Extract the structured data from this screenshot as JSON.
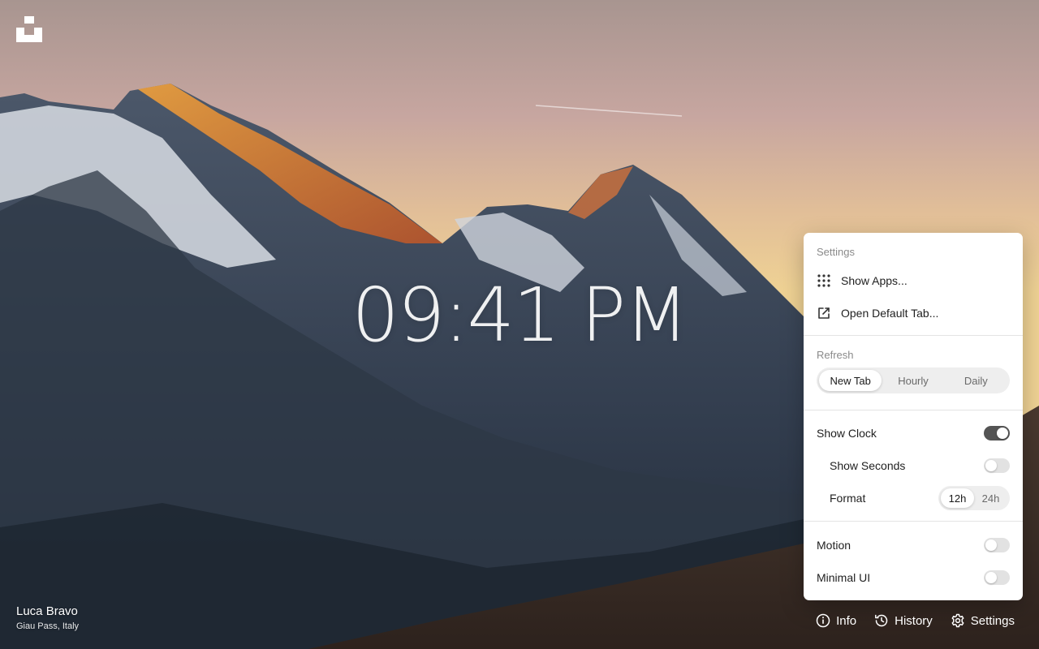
{
  "clock": {
    "time": "09:41 PM"
  },
  "credit": {
    "name": "Luca Bravo",
    "location": "Giau Pass, Italy"
  },
  "settings": {
    "title": "Settings",
    "menu": [
      {
        "label": "Show Apps...",
        "icon": "grid-icon"
      },
      {
        "label": "Open Default Tab...",
        "icon": "external-link-icon"
      }
    ],
    "refresh": {
      "title": "Refresh",
      "options": [
        "New Tab",
        "Hourly",
        "Daily"
      ],
      "selected": "New Tab"
    },
    "show_clock": {
      "label": "Show Clock",
      "on": true
    },
    "show_seconds": {
      "label": "Show Seconds",
      "on": false
    },
    "format": {
      "label": "Format",
      "options": [
        "12h",
        "24h"
      ],
      "selected": "12h"
    },
    "motion": {
      "label": "Motion",
      "on": false
    },
    "minimal_ui": {
      "label": "Minimal UI",
      "on": false
    }
  },
  "footer": {
    "info": {
      "label": "Info",
      "icon": "info-icon"
    },
    "history": {
      "label": "History",
      "icon": "history-icon"
    },
    "settings": {
      "label": "Settings",
      "icon": "gear-icon"
    }
  },
  "colors": {
    "panel_bg": "#ffffff",
    "toggle_on": "#545454",
    "toggle_off": "#e2e2e2"
  }
}
